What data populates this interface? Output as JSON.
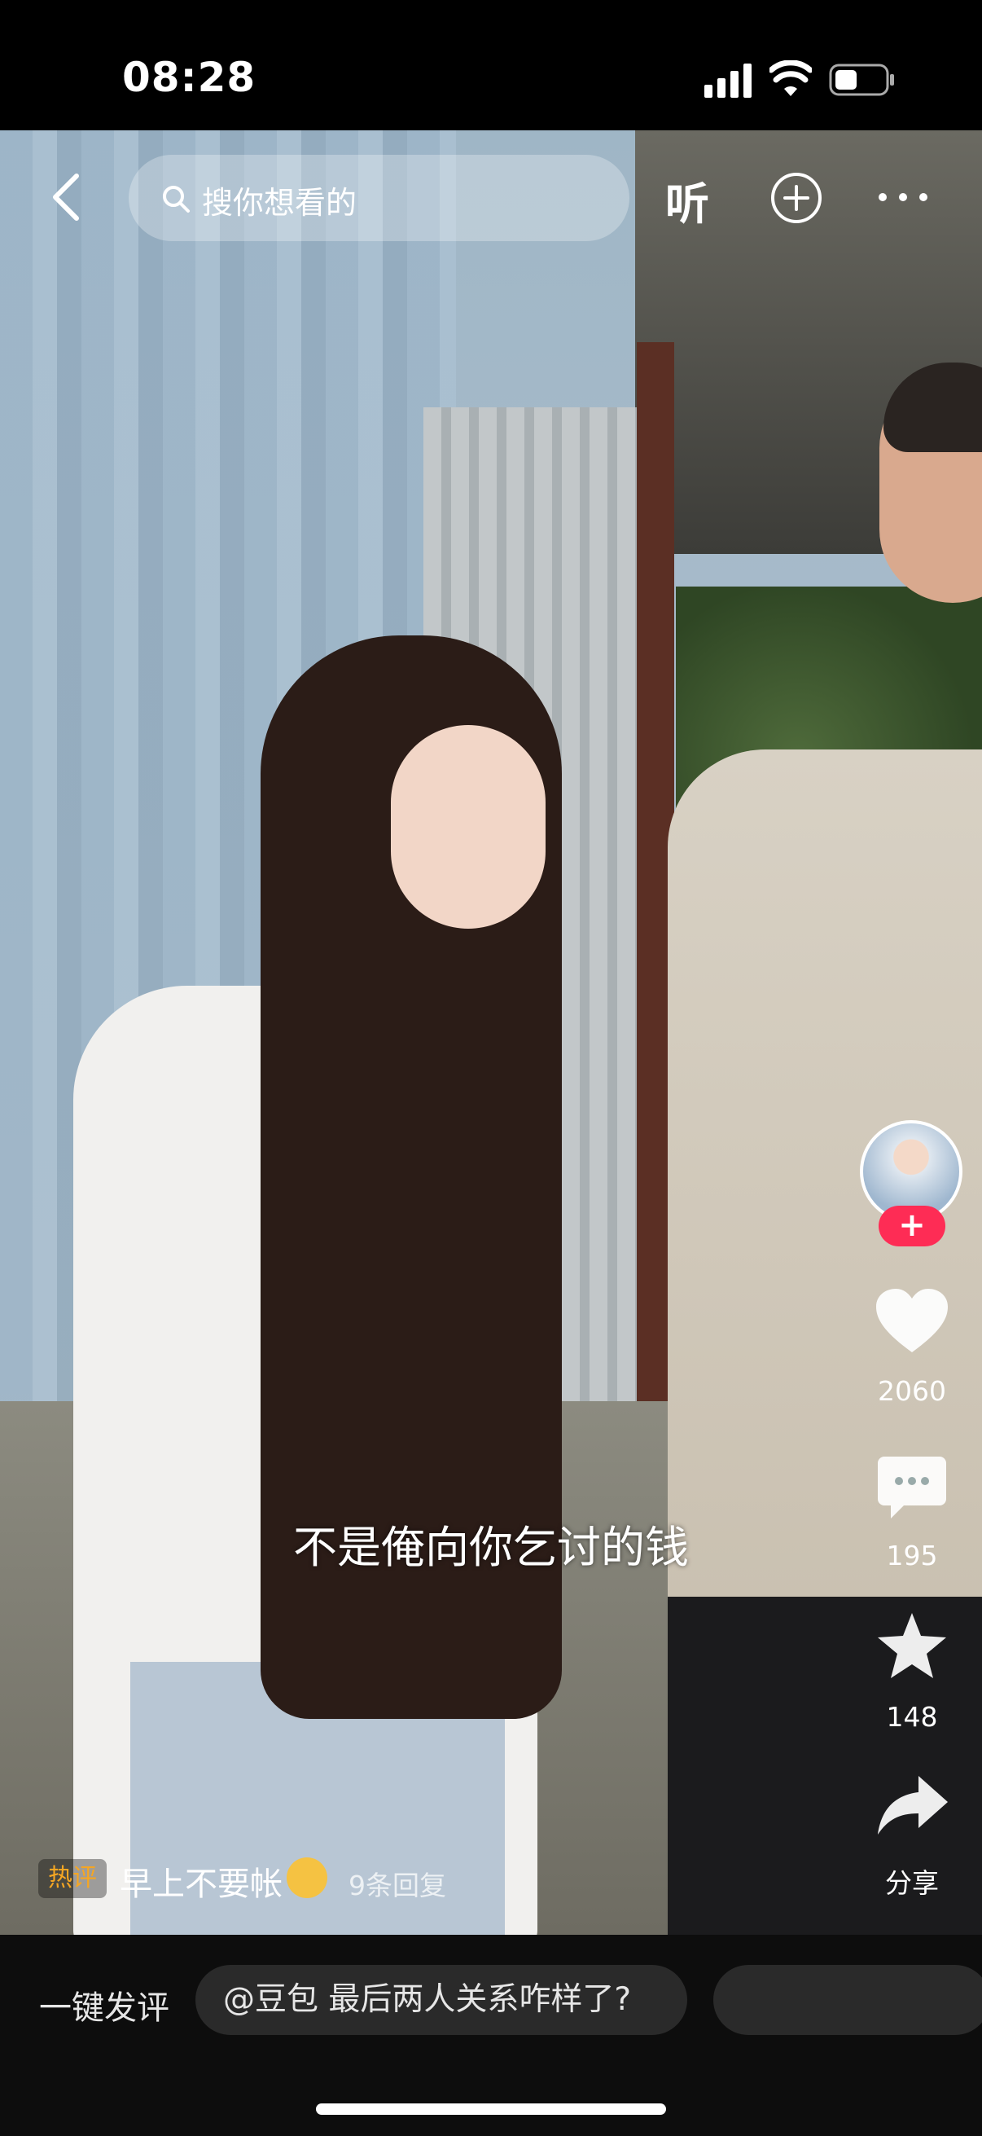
{
  "status_bar": {
    "time": "08:28",
    "signal_icon": "signal-bars-icon",
    "wifi_icon": "wifi-icon",
    "battery_icon": "battery-icon"
  },
  "top_nav": {
    "back_icon": "chevron-left-icon",
    "search_placeholder": "搜你想看的",
    "listen_label": "听",
    "add_icon": "plus-circle-icon",
    "more_icon": "more-icon"
  },
  "video": {
    "caption": "不是俺向你乞讨的钱"
  },
  "right_rail": {
    "follow_label": "+",
    "likes": "2060",
    "comments": "195",
    "favorites": "148",
    "share_label": "分享",
    "accent": "#fe2c55"
  },
  "hot_comment": {
    "tag": "热评",
    "text": "早上不要帐",
    "replies": "9条回复"
  },
  "bottom_bar": {
    "quick_comment_label": "一键发评",
    "suggestions": [
      "@豆包 最后两人关系咋样了?",
      ""
    ]
  }
}
